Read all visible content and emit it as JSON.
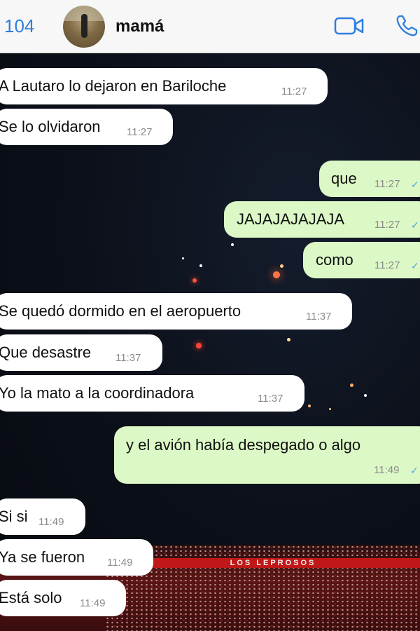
{
  "header": {
    "back_count": "104",
    "contact_name": "mamá",
    "video_icon": "video-camera-icon",
    "phone_icon": "phone-icon"
  },
  "colors": {
    "accent": "#2f7ee0",
    "incoming_bubble": "#ffffff",
    "outgoing_bubble": "#dcf8c6",
    "read_ticks": "#53a6e6"
  },
  "messages": [
    {
      "dir": "in",
      "text": "A Lautaro lo dejaron en Bariloche",
      "time": "11:27"
    },
    {
      "dir": "in",
      "text": "Se lo olvidaron",
      "time": "11:27"
    },
    {
      "dir": "out",
      "text": "que",
      "time": "11:27",
      "status": "read"
    },
    {
      "dir": "out",
      "text": "JAJAJAJAJAJA",
      "time": "11:27",
      "status": "read"
    },
    {
      "dir": "out",
      "text": "como",
      "time": "11:27",
      "status": "read"
    },
    {
      "dir": "in",
      "text": "Se quedó dormido en el aeropuerto",
      "time": "11:37"
    },
    {
      "dir": "in",
      "text": "Que desastre",
      "time": "11:37"
    },
    {
      "dir": "in",
      "text": "Yo la mato a la coordinadora",
      "time": "11:37"
    },
    {
      "dir": "out",
      "text": "y el avión había despegado o algo",
      "time": "11:49",
      "status": "read"
    },
    {
      "dir": "in",
      "text": "Si si",
      "time": "11:49"
    },
    {
      "dir": "in",
      "text": "Ya se fueron",
      "time": "11:49"
    },
    {
      "dir": "in",
      "text": "Está solo",
      "time": "11:49"
    }
  ],
  "background": {
    "banner_text": "LOS LEPROSOS"
  }
}
